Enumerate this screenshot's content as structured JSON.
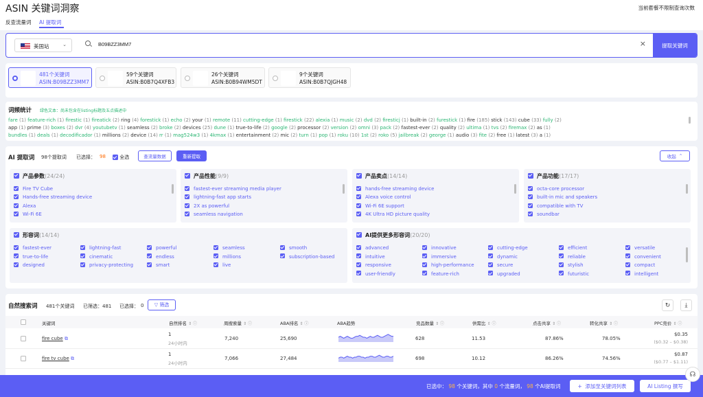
{
  "header": {
    "title": "ASIN 关键词洞察",
    "notice": "当前套餐不限制查询次数",
    "tabs": [
      "反查流量词",
      "AI 提取词"
    ]
  },
  "search": {
    "region": "美国站",
    "value": "B09BZZ3MM7",
    "button": "提取关键词"
  },
  "asins": [
    {
      "count": "481个关键词",
      "asin": "ASIN:B09BZZ3MM7",
      "selected": true
    },
    {
      "count": "59个关键词",
      "asin": "ASIN:B0B7Q4XFB3",
      "selected": false
    },
    {
      "count": "26个关键词",
      "asin": "ASIN:B0B94WM5DT",
      "selected": false
    },
    {
      "count": "9个关键词",
      "asin": "ASIN:B0B7QJGH48",
      "selected": false
    }
  ],
  "freq": {
    "title": "词频统计",
    "note": "绿色文本：尚未包含在listing标题及五点描述中",
    "rows": [
      [
        [
          "fare",
          "1",
          1
        ],
        [
          "feature-rich",
          "1",
          1
        ],
        [
          "firestic",
          "1",
          1
        ],
        [
          "fireatick",
          "2",
          1
        ],
        [
          "ring",
          "4",
          0
        ],
        [
          "forestick",
          "1",
          1
        ],
        [
          "echo",
          "2",
          1
        ],
        [
          "your",
          "1",
          0
        ],
        [
          "remote",
          "11",
          1
        ],
        [
          "cutting-edge",
          "1",
          1
        ],
        [
          "firestick",
          "22",
          1
        ],
        [
          "alexia",
          "1",
          1
        ],
        [
          "music",
          "2",
          1
        ],
        [
          "dvd",
          "2",
          1
        ],
        [
          "firesticj",
          "1",
          1
        ],
        [
          "built-in",
          "2",
          0
        ],
        [
          "furestick",
          "1",
          1
        ],
        [
          "fire",
          "185",
          0
        ],
        [
          "stick",
          "143",
          0
        ],
        [
          "cube",
          "33",
          0
        ],
        [
          "fully",
          "2",
          1
        ]
      ],
      [
        [
          "app",
          "1",
          0
        ],
        [
          "prime",
          "3",
          0
        ],
        [
          "boxes",
          "2",
          1
        ],
        [
          "dvr",
          "4",
          1
        ],
        [
          "youtubetv",
          "1",
          1
        ],
        [
          "seamless",
          "2",
          0
        ],
        [
          "broke",
          "2",
          1
        ],
        [
          "devices",
          "25",
          0
        ],
        [
          "dune",
          "1",
          1
        ],
        [
          "true-to-life",
          "2",
          0
        ],
        [
          "google",
          "2",
          1
        ],
        [
          "processor",
          "2",
          0
        ],
        [
          "version",
          "2",
          1
        ],
        [
          "omni",
          "3",
          1
        ],
        [
          "pack",
          "2",
          1
        ],
        [
          "fastest-ever",
          "2",
          0
        ],
        [
          "quality",
          "2",
          0
        ],
        [
          "ultima",
          "1",
          1
        ],
        [
          "tvs",
          "2",
          1
        ],
        [
          "firemax",
          "2",
          1
        ],
        [
          "as",
          "1",
          0
        ]
      ],
      [
        [
          "bundles",
          "1",
          1
        ],
        [
          "deals",
          "1",
          1
        ],
        [
          "decodificador",
          "1",
          1
        ],
        [
          "millions",
          "2",
          0
        ],
        [
          "device",
          "14",
          0
        ],
        [
          "rr",
          "1",
          1
        ],
        [
          "mag524w3",
          "1",
          1
        ],
        [
          "4kmax",
          "1",
          1
        ],
        [
          "entertainment",
          "2",
          0
        ],
        [
          "mic",
          "2",
          0
        ],
        [
          "turn",
          "1",
          1
        ],
        [
          "pop",
          "1",
          1
        ],
        [
          "roku",
          "10",
          1
        ],
        [
          "1st",
          "2",
          1
        ],
        [
          "roko",
          "5",
          1
        ],
        [
          "jailbreak",
          "2",
          1
        ],
        [
          "george",
          "1",
          1
        ],
        [
          "audio",
          "3",
          0
        ],
        [
          "fite",
          "2",
          1
        ],
        [
          "free",
          "1",
          0
        ],
        [
          "latest",
          "3",
          0
        ],
        [
          "a",
          "1",
          0
        ]
      ]
    ]
  },
  "ai": {
    "title": "AI 提取词",
    "total": "98个提取词",
    "selected_label": "已选择：",
    "selected_count": "98",
    "select_all": "全选",
    "flow_btn": "查流量数据",
    "reextract_btn": "重新提取",
    "collapse_btn": "收起",
    "panels": [
      {
        "title": "产品参数",
        "count": "(24/24)",
        "items": [
          "Fire TV Cube",
          "Hands-free streaming device",
          "Alexa",
          "Wi-Fi 6E"
        ]
      },
      {
        "title": "产品性能",
        "count": "(9/9)",
        "items": [
          "fastest-ever streaming media player",
          "lightning-fast app starts",
          "2X as powerful",
          "seamless navigation"
        ]
      },
      {
        "title": "产品卖点",
        "count": "(14/14)",
        "items": [
          "hands-free streaming device",
          "Alexa voice control",
          "Wi-Fi 6E support",
          "4K Ultra HD picture quality"
        ]
      },
      {
        "title": "产品功能",
        "count": "(17/17)",
        "items": [
          "octa-core processor",
          "built-in mic and speakers",
          "compatible with TV",
          "soundbar"
        ]
      }
    ],
    "adj": {
      "title": "形容词",
      "count": "(14/14)",
      "columns": [
        [
          "fastest-ever",
          "true-to-life",
          "designed"
        ],
        [
          "lightning-fast",
          "cinematic",
          "privacy-protecting"
        ],
        [
          "powerful",
          "endless",
          "smart"
        ],
        [
          "seamless",
          "millions",
          "live"
        ],
        [
          "smooth",
          "subscription-based"
        ]
      ]
    },
    "more": {
      "title": "AI提供更多形容词",
      "count": "(20/20)",
      "columns": [
        [
          "advanced",
          "intuitive",
          "responsive",
          "user-friendly"
        ],
        [
          "innovative",
          "immersive",
          "high-performance",
          "feature-rich"
        ],
        [
          "cutting-edge",
          "dynamic",
          "secure",
          "upgraded"
        ],
        [
          "efficient",
          "reliable",
          "stylish",
          "futuristic"
        ],
        [
          "versatile",
          "convenient",
          "compact",
          "intelligent"
        ]
      ]
    }
  },
  "natural": {
    "title": "自然搜索词",
    "total": "481个关键词",
    "filtered": "已筛选：481",
    "selected_label": "已选择：",
    "selected_count": "0",
    "filter_btn": "筛选",
    "columns": [
      "关键词",
      "自然排名",
      "周搜索量",
      "ABA排名",
      "ABA趋势",
      "竞品数量",
      "供需比",
      "点击共享",
      "转化共享",
      "PPC竞价"
    ],
    "rows": [
      {
        "kw": "fire cube",
        "rank": "1",
        "rank_sub": "24小时内",
        "volume": "7,240",
        "aba": "25,690",
        "trend": [
          5,
          6,
          5,
          4,
          5,
          6,
          5,
          4,
          4,
          5,
          6,
          6,
          7,
          6,
          5,
          5,
          4,
          5,
          6,
          5,
          5,
          6,
          7,
          6,
          5,
          5,
          6,
          7,
          8,
          7,
          6,
          6
        ],
        "comp": "628",
        "ratio": "11.53",
        "click": "87.86%",
        "conv": "78.05%",
        "ppc": "$0.35",
        "ppc_range": "($0.32 – $0.38)"
      },
      {
        "kw": "fire tv cube",
        "rank": "1",
        "rank_sub": "24小时内",
        "volume": "7,066",
        "aba": "27,484",
        "trend": [
          4,
          5,
          5,
          4,
          5,
          6,
          5,
          5,
          4,
          5,
          5,
          6,
          6,
          5,
          5,
          4,
          5,
          5,
          6,
          6,
          5,
          5,
          6,
          7,
          6,
          5,
          5,
          6,
          6,
          5,
          5,
          6
        ],
        "comp": "698",
        "ratio": "10.12",
        "click": "86.26%",
        "conv": "74.56%",
        "ppc": "$0.87",
        "ppc_range": "($0.77 – $1.11)"
      }
    ]
  },
  "bottom": {
    "prefix": "已选中：",
    "kw_count": "98",
    "mid1": "个关键词，其中",
    "flow_count": "0",
    "mid2": "个流量词，",
    "ai_count": "98",
    "suffix": "个AI提取词",
    "add_btn": "添加至关键词列表",
    "listing_btn": "AI Listing 撰写"
  },
  "colors": {
    "accent": "#5b5ef4",
    "green": "#2bb673",
    "orange": "#ff6a00"
  }
}
